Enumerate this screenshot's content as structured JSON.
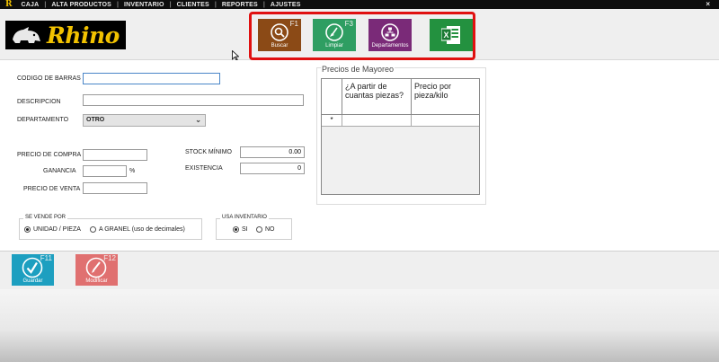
{
  "menu": {
    "items": [
      "CAJA",
      "ALTA PRODUCTOS",
      "INVENTARIO",
      "CLIENTES",
      "REPORTES",
      "AJUSTES"
    ],
    "close": "×"
  },
  "brand": {
    "name": "Rhino",
    "color": "#f2c200"
  },
  "toolbar": {
    "buttons": [
      {
        "key": "F1",
        "label": "Buscar",
        "color": "#8b4a16",
        "icon": "search-icon"
      },
      {
        "key": "F3",
        "label": "Limpiar",
        "color": "#2e9e62",
        "icon": "clean-icon"
      },
      {
        "key": "",
        "label": "Departamentos",
        "color": "#7a2a78",
        "icon": "departments-icon"
      },
      {
        "key": "",
        "label": "",
        "color": "#23913f",
        "icon": "excel-icon"
      }
    ],
    "highlight_color": "#e01010"
  },
  "form": {
    "codigo_label": "CODIGO DE BARRAS",
    "codigo_value": "",
    "descripcion_label": "DESCRIPCION",
    "descripcion_value": "",
    "departamento_label": "DEPARTAMENTO",
    "departamento_value": "OTRO",
    "precio_compra_label": "PRECIO DE COMPRA",
    "precio_compra_value": "",
    "ganancia_label": "GANANCIA",
    "ganancia_value": "",
    "ganancia_unit": "%",
    "precio_venta_label": "PRECIO DE VENTA",
    "precio_venta_value": "",
    "stock_minimo_label": "STOCK MÍNIMO",
    "stock_minimo_value": "0.00",
    "existencia_label": "EXISTENCIA",
    "existencia_value": "0"
  },
  "se_vende_por": {
    "title": "SE VENDE POR",
    "options": [
      "UNIDAD / PIEZA",
      "A GRANEL (uso de decimales)"
    ],
    "selected": 0
  },
  "usa_inventario": {
    "title": "USA INVENTARIO",
    "options": [
      "SI",
      "NO"
    ],
    "selected": 0
  },
  "mayoreo": {
    "title": "Precios de Mayoreo",
    "columns": [
      "¿A partir de cuantas piezas?",
      "Precio por pieza/kilo"
    ],
    "new_row_marker": "*"
  },
  "footer": {
    "buttons": [
      {
        "key": "F11",
        "label": "Guardar",
        "color": "#1d9fc0",
        "icon": "check-icon"
      },
      {
        "key": "F12",
        "label": "Modificar",
        "color": "#e07070",
        "icon": "edit-icon"
      }
    ]
  }
}
